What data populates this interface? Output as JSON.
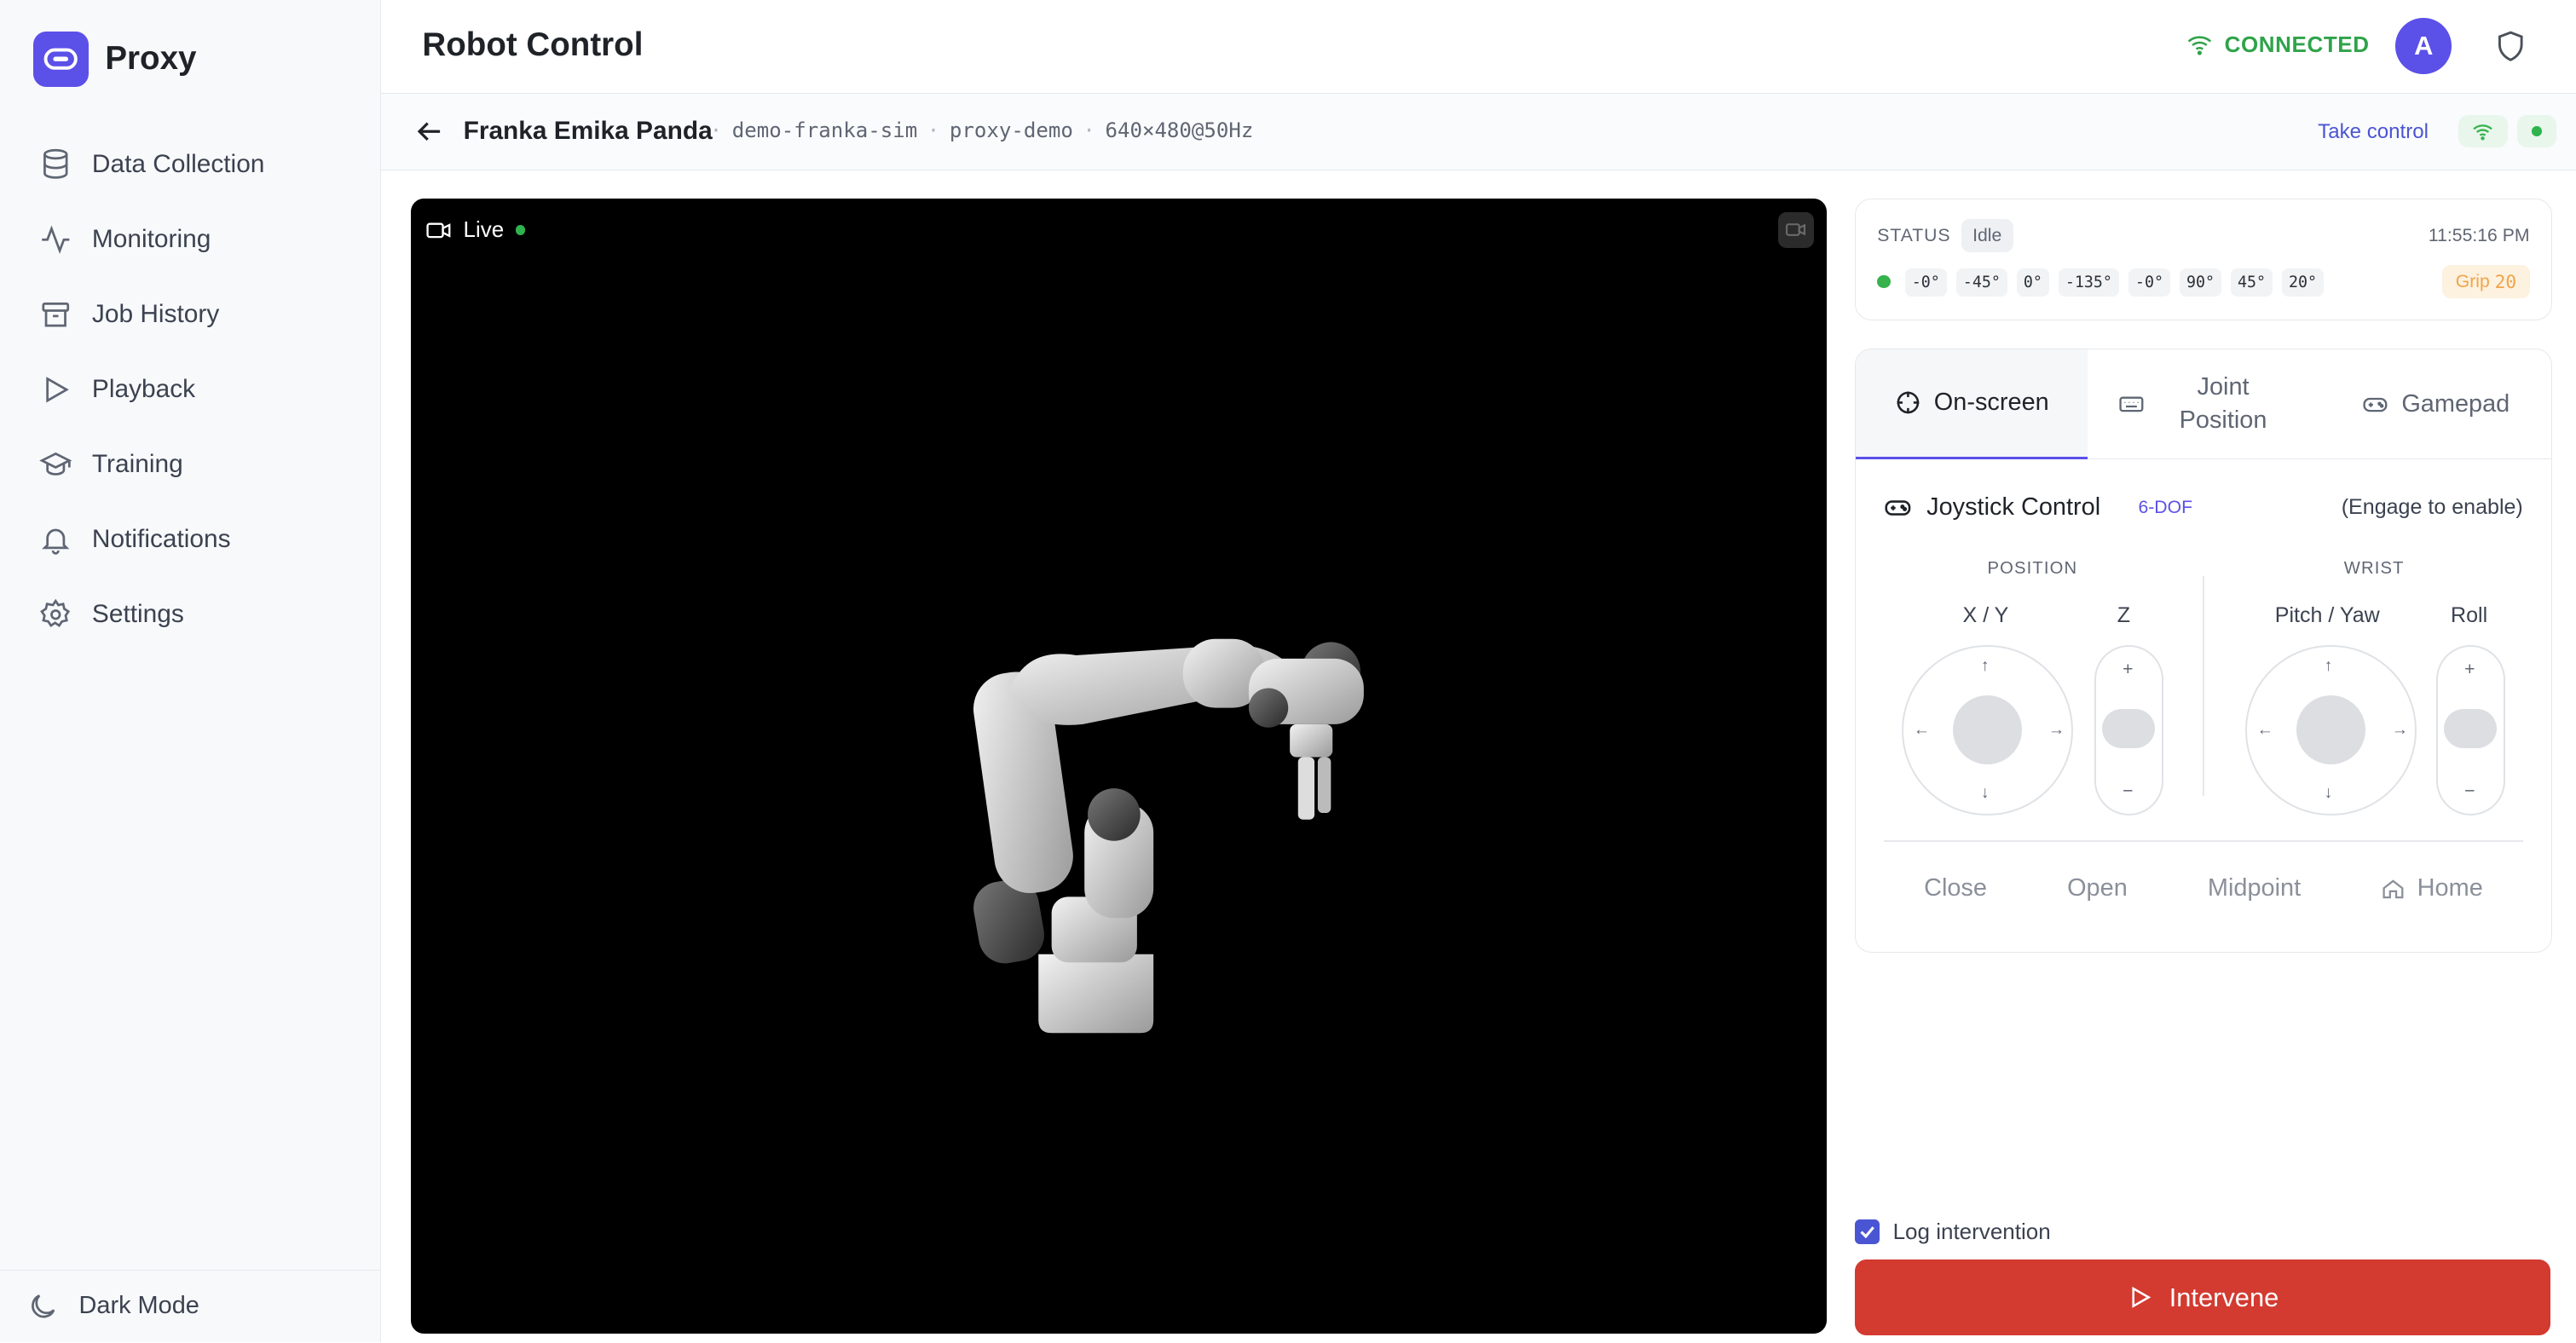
{
  "app": {
    "name": "Proxy"
  },
  "sidebar": {
    "items": [
      {
        "label": "Data Collection",
        "icon": "database-icon"
      },
      {
        "label": "Monitoring",
        "icon": "activity-icon"
      },
      {
        "label": "Job History",
        "icon": "archive-icon"
      },
      {
        "label": "Playback",
        "icon": "play-icon"
      },
      {
        "label": "Training",
        "icon": "graduation-cap-icon"
      },
      {
        "label": "Notifications",
        "icon": "bell-icon"
      },
      {
        "label": "Settings",
        "icon": "gear-icon"
      }
    ],
    "footer": {
      "label": "Dark Mode",
      "icon": "moon-icon"
    }
  },
  "header": {
    "title": "Robot Control",
    "connection": "CONNECTED",
    "avatar_initial": "A"
  },
  "subheader": {
    "robot_name": "Franka Emika Panda",
    "meta": [
      "demo-franka-sim",
      "proxy-demo",
      "640×480@50Hz"
    ],
    "separator": "·",
    "take_control": "Take control"
  },
  "video": {
    "live_label": "Live"
  },
  "status": {
    "label": "STATUS",
    "state": "Idle",
    "time": "11:55:16 PM",
    "joints": [
      "-0°",
      "-45°",
      "0°",
      "-135°",
      "-0°",
      "90°",
      "45°",
      "20°"
    ],
    "grip_label": "Grip",
    "grip_value": "20"
  },
  "control": {
    "tabs": [
      "On-screen",
      "Joint Position",
      "Gamepad"
    ],
    "active_tab": "On-screen",
    "joystick_title": "Joystick Control",
    "dof": "6-DOF",
    "hint": "(Engage to enable)",
    "position_label": "POSITION",
    "wrist_label": "WRIST",
    "axes": [
      "X / Y",
      "Z",
      "Pitch / Yaw",
      "Roll"
    ],
    "plus": "+",
    "minus": "−",
    "actions": [
      "Close",
      "Open",
      "Midpoint",
      "Home"
    ]
  },
  "footer": {
    "log_label": "Log intervention",
    "log_checked": true,
    "intervene_label": "Intervene"
  },
  "colors": {
    "accent": "#5b50e8",
    "connected": "#2fa34a",
    "danger": "#d33a30",
    "grip": "#f0a54a"
  }
}
